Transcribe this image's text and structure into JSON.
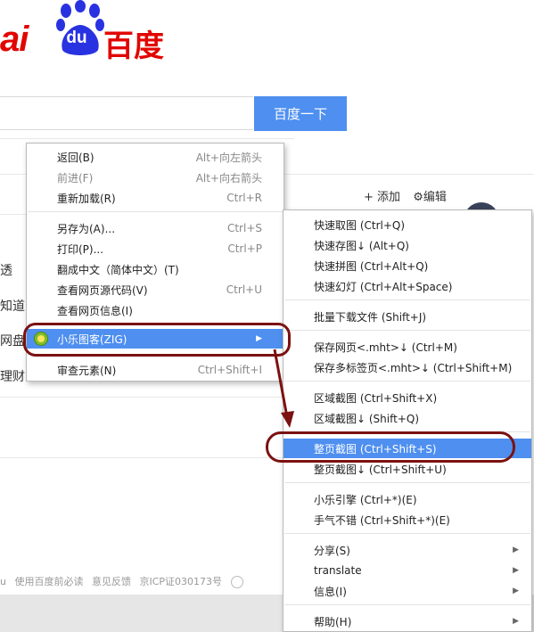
{
  "logo": {
    "text_ai": "ai",
    "text_du": "du",
    "text_cn": "百度"
  },
  "search": {
    "placeholder": "",
    "button_label": "百度一下"
  },
  "feed": {
    "add_label": "添加",
    "edit_label": "编辑",
    "items": [
      "透",
      "知道",
      "网盘",
      "理财"
    ]
  },
  "footer": {
    "prefix": "u",
    "links": [
      "使用百度前必读",
      "意见反馈",
      "京ICP证030173号"
    ]
  },
  "context_menu": {
    "items": [
      {
        "label": "返回(B)",
        "shortcut": "Alt+向左箭头",
        "disabled": false
      },
      {
        "label": "前进(F)",
        "shortcut": "Alt+向右箭头",
        "disabled": true
      },
      {
        "label": "重新加载(R)",
        "shortcut": "Ctrl+R",
        "disabled": false
      },
      {
        "label": "另存为(A)...",
        "shortcut": "Ctrl+S",
        "disabled": false
      },
      {
        "label": "打印(P)...",
        "shortcut": "Ctrl+P",
        "disabled": false
      },
      {
        "label": "翻成中文（简体中文）(T)",
        "shortcut": "",
        "disabled": false
      },
      {
        "label": "查看网页源代码(V)",
        "shortcut": "Ctrl+U",
        "disabled": false
      },
      {
        "label": "查看网页信息(I)",
        "shortcut": "",
        "disabled": false
      },
      {
        "label": "小乐图客(ZIG)",
        "shortcut": "",
        "disabled": false
      },
      {
        "label": "审查元素(N)",
        "shortcut": "Ctrl+Shift+I",
        "disabled": false
      }
    ]
  },
  "submenu": {
    "items": [
      "快速取图 (Ctrl+Q)",
      "快速存图↓ (Alt+Q)",
      "快速拼图 (Ctrl+Alt+Q)",
      "快速幻灯 (Ctrl+Alt+Space)",
      "批量下载文件 (Shift+J)",
      "保存网页<.mht>↓ (Ctrl+M)",
      "保存多标签页<.mht>↓ (Ctrl+Shift+M)",
      "区域截图 (Ctrl+Shift+X)",
      "区域截图↓ (Shift+Q)",
      "整页截图 (Ctrl+Shift+S)",
      "整页截图↓ (Ctrl+Shift+U)",
      "小乐引擎 (Ctrl+*)(E)",
      "手气不错 (Ctrl+Shift+*)(E)",
      "分享(S)",
      "translate",
      "信息(I)",
      "帮助(H)"
    ]
  },
  "colors": {
    "brand_red": "#e10602",
    "brand_blue": "#2932e1",
    "highlight": "#4e8ff0",
    "annotation": "#7b1111"
  }
}
